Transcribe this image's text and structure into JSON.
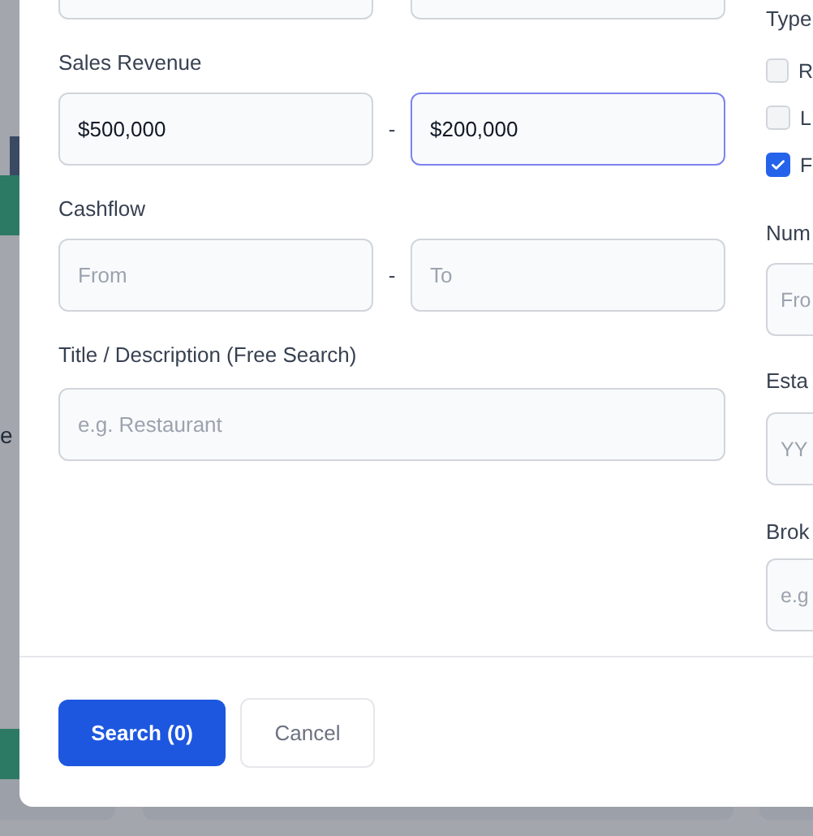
{
  "backdrop": {
    "snippet": "e"
  },
  "ranges": [
    {
      "label": "Sales Revenue",
      "separator": "-",
      "from": {
        "value": "$500,000",
        "focused": false
      },
      "to": {
        "value": "$200,000",
        "focused": true
      }
    },
    {
      "label": "Cashflow",
      "separator": "-",
      "from": {
        "placeholder": "From",
        "focused": false
      },
      "to": {
        "placeholder": "To",
        "focused": false
      }
    }
  ],
  "free_search": {
    "label": "Title / Description (Free Search)",
    "placeholder": "e.g. Restaurant"
  },
  "type_filter": {
    "label": "Type",
    "options": [
      {
        "label": "R",
        "checked": false
      },
      {
        "label": "L",
        "checked": false
      },
      {
        "label": "F",
        "checked": true
      }
    ]
  },
  "side_fields": [
    {
      "label": "Num",
      "placeholder": "Fro"
    },
    {
      "label": "Esta",
      "placeholder": "YY"
    },
    {
      "label": "Brok",
      "placeholder": "e.g"
    }
  ],
  "buttons": [
    {
      "label": "Search (0)",
      "kind": "primary"
    },
    {
      "label": "Cancel",
      "kind": "secondary"
    }
  ]
}
